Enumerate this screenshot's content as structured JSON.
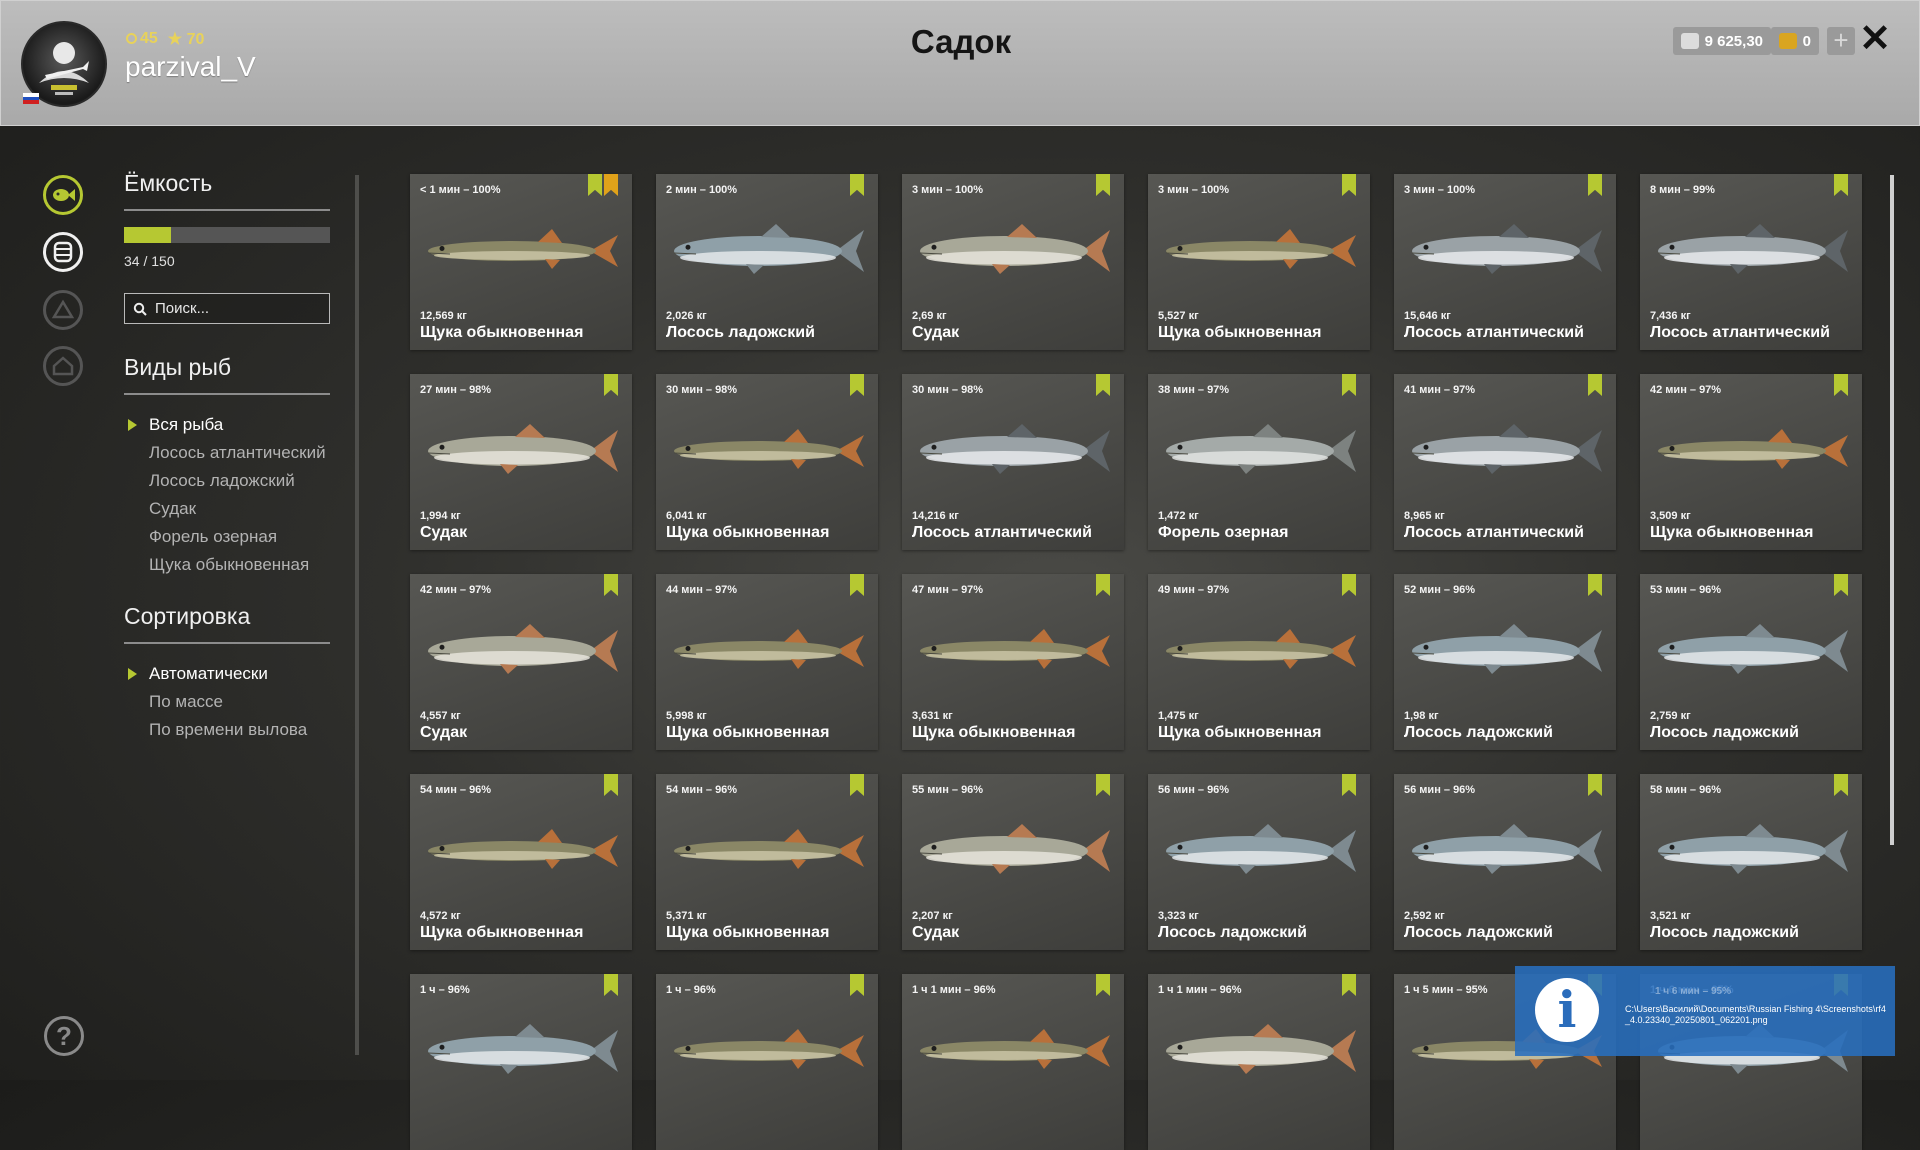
{
  "header": {
    "title": "Садок",
    "username": "parzival_V",
    "level": "45",
    "rating": "70",
    "silver": "9 625,30",
    "gold": "0",
    "plus": "+",
    "close": "✕"
  },
  "side": {
    "capacity_title": "Ёмкость",
    "capacity_text": "34 / 150",
    "capacity_fraction": 0.227,
    "search_placeholder": "Поиск...",
    "species_title": "Виды рыб",
    "species": [
      {
        "label": "Вся рыба",
        "active": true
      },
      {
        "label": "Лосось атлантический",
        "active": false
      },
      {
        "label": "Лосось ладожский",
        "active": false
      },
      {
        "label": "Судак",
        "active": false
      },
      {
        "label": "Форель озерная",
        "active": false
      },
      {
        "label": "Щука обыкновенная",
        "active": false
      }
    ],
    "sort_title": "Сортировка",
    "sort": [
      {
        "label": "Автоматически",
        "active": true
      },
      {
        "label": "По массе",
        "active": false
      },
      {
        "label": "По времени вылова",
        "active": false
      }
    ],
    "help": "?"
  },
  "colors": {
    "accent": "#b6c832",
    "star": "#e0a21a",
    "header_bg": "#b3b3b3",
    "notify_bg": "#2a6cbb"
  },
  "fish": [
    {
      "time": "< 1 мин – 100%",
      "weight": "12,569 кг",
      "name": "Щука обыкновенная",
      "kind": "pike",
      "starred": true
    },
    {
      "time": "2 мин – 100%",
      "weight": "2,026 кг",
      "name": "Лосось ладожский",
      "kind": "salmon"
    },
    {
      "time": "3 мин – 100%",
      "weight": "2,69 кг",
      "name": "Судак",
      "kind": "zander"
    },
    {
      "time": "3 мин – 100%",
      "weight": "5,527 кг",
      "name": "Щука обыкновенная",
      "kind": "pike"
    },
    {
      "time": "3 мин – 100%",
      "weight": "15,646 кг",
      "name": "Лосось атлантический",
      "kind": "atlantic"
    },
    {
      "time": "8 мин – 99%",
      "weight": "7,436 кг",
      "name": "Лосось атлантический",
      "kind": "atlantic"
    },
    {
      "time": "27 мин – 98%",
      "weight": "1,994 кг",
      "name": "Судак",
      "kind": "zander"
    },
    {
      "time": "30 мин – 98%",
      "weight": "6,041 кг",
      "name": "Щука обыкновенная",
      "kind": "pike"
    },
    {
      "time": "30 мин – 98%",
      "weight": "14,216 кг",
      "name": "Лосось атлантический",
      "kind": "atlantic"
    },
    {
      "time": "38 мин – 97%",
      "weight": "1,472 кг",
      "name": "Форель озерная",
      "kind": "trout"
    },
    {
      "time": "41 мин – 97%",
      "weight": "8,965 кг",
      "name": "Лосось атлантический",
      "kind": "atlantic"
    },
    {
      "time": "42 мин – 97%",
      "weight": "3,509 кг",
      "name": "Щука обыкновенная",
      "kind": "pike"
    },
    {
      "time": "42 мин – 97%",
      "weight": "4,557 кг",
      "name": "Судак",
      "kind": "zander"
    },
    {
      "time": "44 мин – 97%",
      "weight": "5,998 кг",
      "name": "Щука обыкновенная",
      "kind": "pike"
    },
    {
      "time": "47 мин – 97%",
      "weight": "3,631 кг",
      "name": "Щука обыкновенная",
      "kind": "pike"
    },
    {
      "time": "49 мин – 97%",
      "weight": "1,475 кг",
      "name": "Щука обыкновенная",
      "kind": "pike"
    },
    {
      "time": "52 мин – 96%",
      "weight": "1,98 кг",
      "name": "Лосось ладожский",
      "kind": "salmon"
    },
    {
      "time": "53 мин – 96%",
      "weight": "2,759 кг",
      "name": "Лосось ладожский",
      "kind": "salmon"
    },
    {
      "time": "54 мин – 96%",
      "weight": "4,572 кг",
      "name": "Щука обыкновенная",
      "kind": "pike"
    },
    {
      "time": "54 мин – 96%",
      "weight": "5,371 кг",
      "name": "Щука обыкновенная",
      "kind": "pike"
    },
    {
      "time": "55 мин – 96%",
      "weight": "2,207 кг",
      "name": "Судак",
      "kind": "zander"
    },
    {
      "time": "56 мин – 96%",
      "weight": "3,323 кг",
      "name": "Лосось ладожский",
      "kind": "salmon"
    },
    {
      "time": "56 мин – 96%",
      "weight": "2,592 кг",
      "name": "Лосось ладожский",
      "kind": "salmon"
    },
    {
      "time": "58 мин – 96%",
      "weight": "3,521 кг",
      "name": "Лосось ладожский",
      "kind": "salmon"
    },
    {
      "time": "1 ч – 96%",
      "weight": "",
      "name": "",
      "kind": "salmon"
    },
    {
      "time": "1 ч – 96%",
      "weight": "",
      "name": "",
      "kind": "pike"
    },
    {
      "time": "1 ч 1 мин – 96%",
      "weight": "",
      "name": "",
      "kind": "pike"
    },
    {
      "time": "1 ч 1 мин – 96%",
      "weight": "",
      "name": "",
      "kind": "zander"
    },
    {
      "time": "1 ч 5 мин – 95%",
      "weight": "",
      "name": "",
      "kind": "pike"
    },
    {
      "time": "1 ч 6 мин – 95%",
      "weight": "",
      "name": "",
      "kind": "salmon"
    }
  ],
  "notification": {
    "ghost": "1 ч 6 мин – 95%",
    "text": "C:\\Users\\Василий\\Documents\\Russian Fishing 4\\Screenshots\\rf4_4.0.23340_20250801_062201.png",
    "icon": "i"
  }
}
